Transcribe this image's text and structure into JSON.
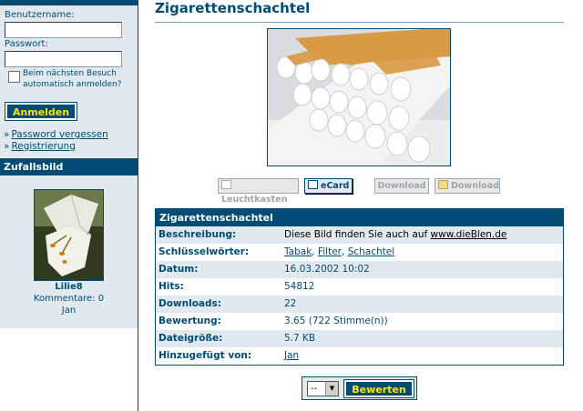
{
  "sidebar": {
    "login": {
      "username_label": "Benutzername:",
      "username_value": "",
      "password_label": "Passwort:",
      "password_value": "",
      "remember_label_line1": "Beim nächsten Besuch",
      "remember_label_line2": "automatisch anmelden?",
      "remember_checked": false,
      "submit_label": "Anmelden"
    },
    "links": {
      "arrow": "»",
      "forgot_password": "Password vergessen",
      "register": "Registrierung"
    },
    "random_image": {
      "heading": "Zufallsbild",
      "name": "Lilie8",
      "comments": "Kommentare: 0",
      "author": "Jan"
    }
  },
  "main": {
    "title": "Zigarettenschachtel",
    "toolbar": {
      "lightbox": "Leuchtkasten",
      "ecard": "eCard",
      "download": "Download",
      "download_zip": "Download"
    },
    "info": {
      "heading": "Zigarettenschachtel",
      "rows": {
        "description_key": "Beschreibung:",
        "description_text": "Diese Bild finden Sie auch auf ",
        "description_link": "www.dieBlen.de",
        "keywords_key": "Schlüsselwörter:",
        "keyword1": "Tabak",
        "keyword2": "Filter",
        "keyword3": "Schachtel",
        "separator": ", ",
        "date_key": "Datum:",
        "date_value": "16.03.2002 10:02",
        "hits_key": "Hits:",
        "hits_value": "54812",
        "downloads_key": "Downloads:",
        "downloads_value": "22",
        "rating_key": "Bewertung:",
        "rating_value": "3.65 (722 Stimme(n))",
        "filesize_key": "Dateigröße:",
        "filesize_value": "5.7 KB",
        "added_by_key": "Hinzugefügt von:",
        "added_by_value": "Jan"
      }
    },
    "rating": {
      "select_value": "--",
      "submit_label": "Bewerten"
    }
  },
  "colors": {
    "brand": "#004c75",
    "panel": "#e1e9ee",
    "button_text": "#ffe200"
  }
}
